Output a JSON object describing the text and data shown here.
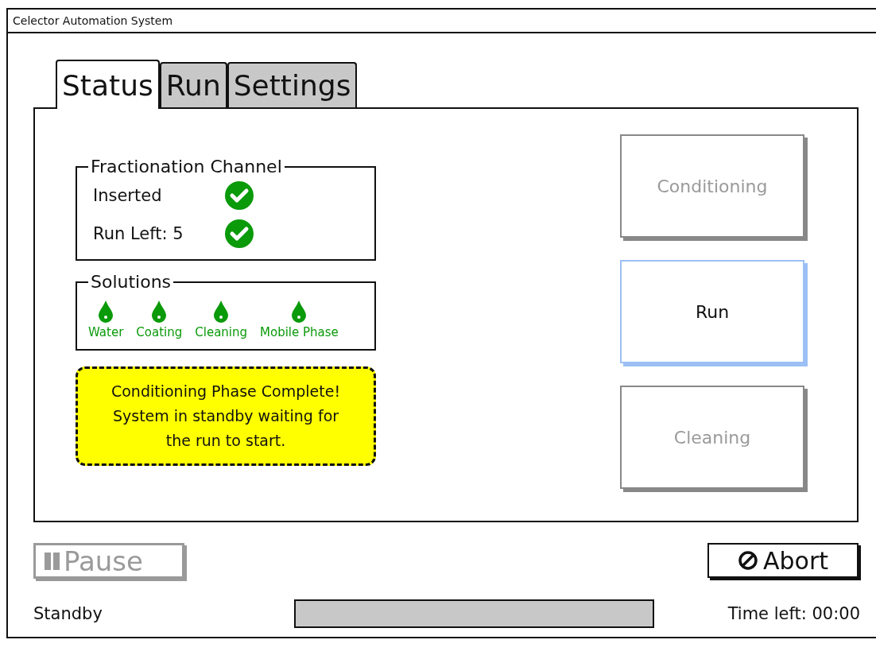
{
  "window": {
    "title": "Celector Automation System"
  },
  "tabs": [
    {
      "label": "Status",
      "selected": true
    },
    {
      "label": "Run",
      "selected": false
    },
    {
      "label": "Settings",
      "selected": false
    }
  ],
  "channel_group": {
    "title": "Fractionation Channel",
    "items": [
      {
        "label": "Inserted",
        "ok": true
      },
      {
        "label": "Run Left: 5",
        "ok": true
      }
    ]
  },
  "solutions_group": {
    "title": "Solutions",
    "items": [
      {
        "label": "Water",
        "available": true
      },
      {
        "label": "Coating",
        "available": true
      },
      {
        "label": "Cleaning",
        "available": true
      },
      {
        "label": "Mobile Phase",
        "available": true
      }
    ]
  },
  "notice": "Conditioning Phase Complete! System in standby waiting for the run to start.",
  "phase_buttons": [
    {
      "label": "Conditioning",
      "disabled": true,
      "selected": false
    },
    {
      "label": "Run",
      "disabled": false,
      "selected": true
    },
    {
      "label": "Cleaning",
      "disabled": true,
      "selected": false
    }
  ],
  "pause_button": {
    "label": "Pause",
    "disabled": true
  },
  "abort_button": {
    "label": "Abort",
    "disabled": false
  },
  "status_bar": {
    "state": "Standby",
    "progress": {
      "level": 0
    },
    "time_left": "Time left: 00:00"
  }
}
